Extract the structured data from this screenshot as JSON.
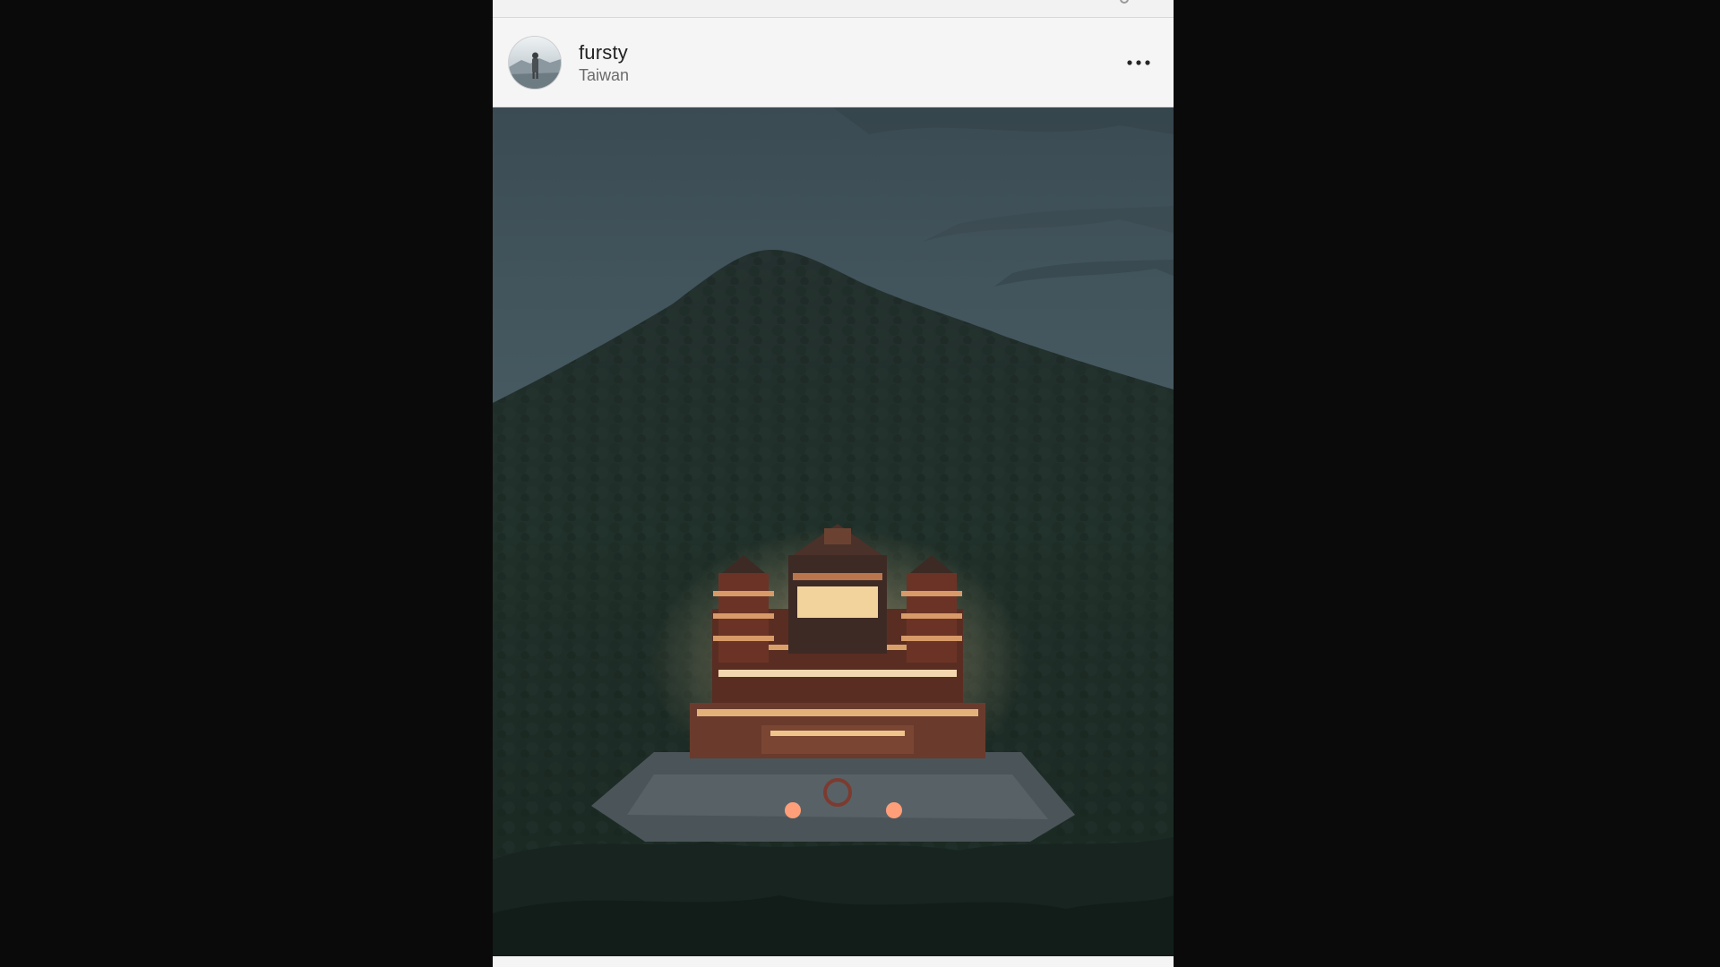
{
  "post": {
    "username": "fursty",
    "location": "Taiwan"
  },
  "icons": {
    "avatar": "profile-photo",
    "more": "more-horizontal-icon",
    "status": "circle-icon"
  },
  "colors": {
    "background": "#0a0a0a",
    "card": "#f5f5f5",
    "username": "#222222",
    "location": "#6b6b6b"
  }
}
